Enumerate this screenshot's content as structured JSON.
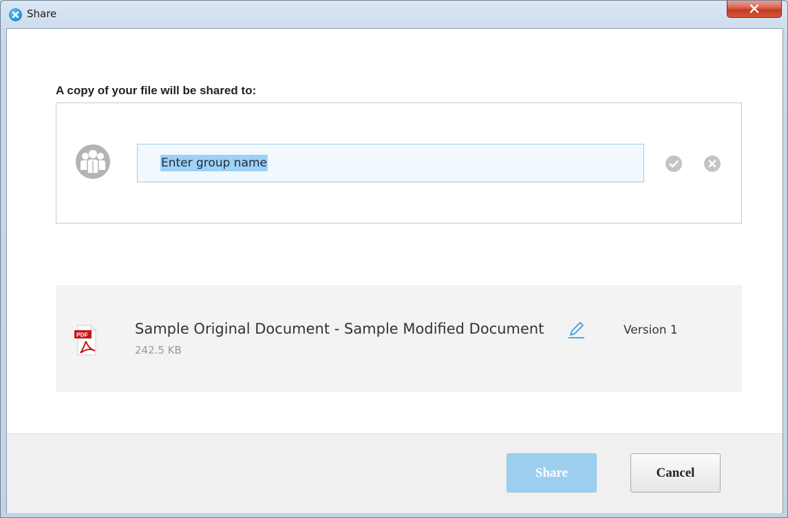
{
  "window": {
    "title": "Share",
    "close_label": "x"
  },
  "dialog": {
    "heading": "A copy of your file will be shared to:",
    "group_input": {
      "placeholder": "Enter group name",
      "value": "Enter group name",
      "selected": true
    }
  },
  "file": {
    "type_badge": "PDF",
    "name": "Sample Original Document - Sample Modified Document",
    "size": "242.5 KB",
    "version": "Version 1"
  },
  "footer": {
    "share_label": "Share",
    "cancel_label": "Cancel"
  },
  "colors": {
    "accent": "#9ccfef",
    "input_selection": "#9fd0f5",
    "pdf_red": "#c4161c",
    "edit_icon": "#3b9be0"
  }
}
